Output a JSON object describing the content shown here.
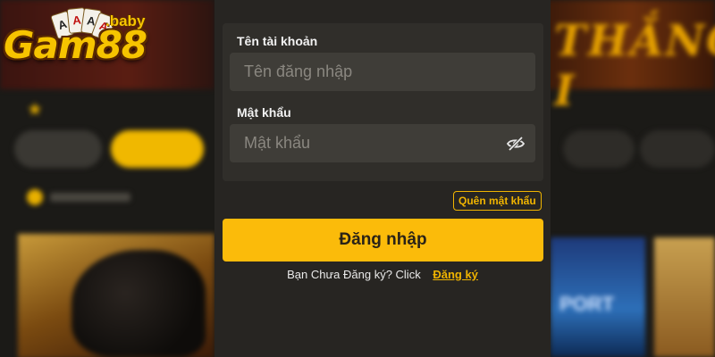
{
  "logo": {
    "wordmark": "Gam88",
    "suffix": ".baby",
    "cards": [
      "A",
      "A",
      "A",
      "A"
    ]
  },
  "background": {
    "banner_text": "THẮNG I",
    "card_text": "PORT"
  },
  "login_form": {
    "username_label": "Tên tài khoản",
    "username_placeholder": "Tên đăng nhập",
    "password_label": "Mật khẩu",
    "password_placeholder": "Mật khẩu",
    "toggle_visibility_icon": "eye-slash-icon",
    "forgot_password": "Quên mật khẩu",
    "submit_label": "Đăng nhập",
    "signup_prompt": "Bạn Chưa Đăng ký? Click",
    "signup_link": "Đăng ký"
  },
  "colors": {
    "accent": "#fbbb0a",
    "modal_bg": "#272522",
    "field_bg": "#3f3d38"
  }
}
